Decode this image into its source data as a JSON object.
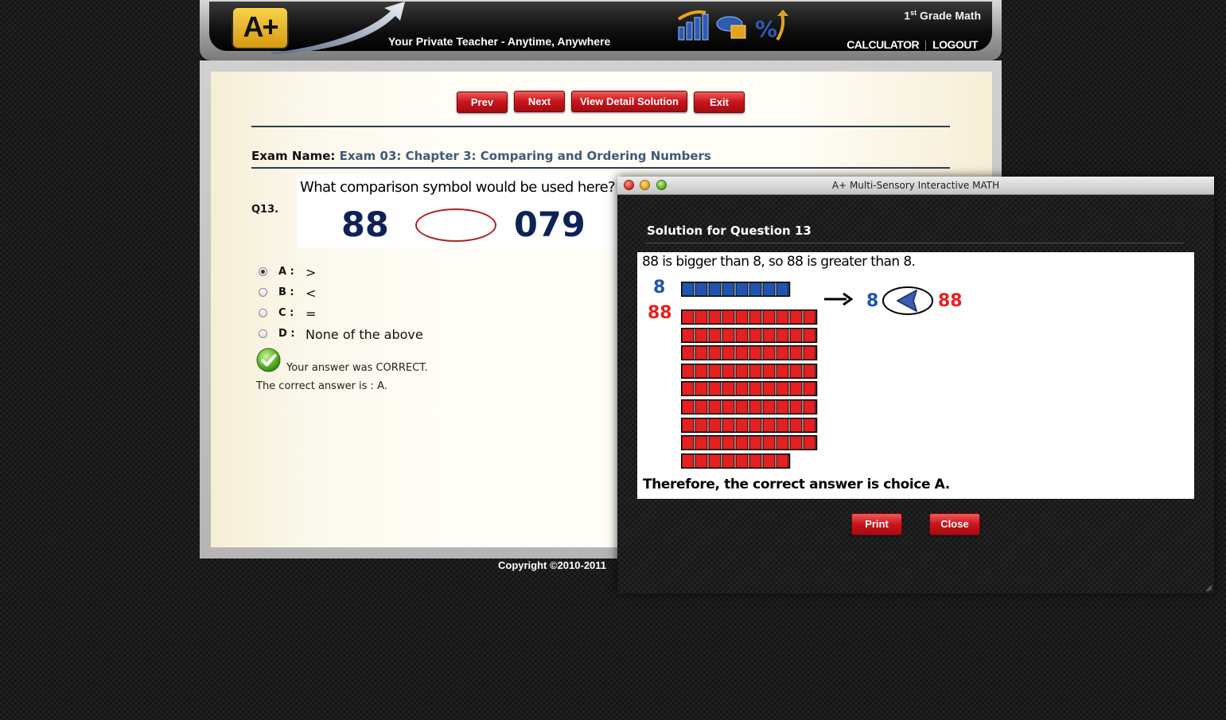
{
  "header": {
    "logo_text": "A+",
    "tagline": "Your Private Teacher - Anytime, Anywhere",
    "grade_num": "1",
    "grade_suffix": "st",
    "grade_rest": " Grade Math",
    "calculator_label": "CALCULATOR",
    "logout_label": "LOGOUT",
    "icons": [
      "bar-chart-icon",
      "geometry-shapes-icon",
      "percent-arrow-icon"
    ]
  },
  "toolbar": {
    "prev_label": "Prev",
    "next_label": "Next",
    "view_solution_label": "View Detail Solution",
    "exit_label": "Exit"
  },
  "exam": {
    "name_label": "Exam Name:",
    "name_value": "Exam 03: Chapter 3: Comparing and Ordering Numbers"
  },
  "question": {
    "number": "Q13.",
    "text": "What comparison symbol would be used here?",
    "left_number": "88",
    "right_number": "079",
    "options": [
      {
        "letter": "A :",
        "text": ">",
        "selected": true
      },
      {
        "letter": "B :",
        "text": "<",
        "selected": false
      },
      {
        "letter": "C :",
        "text": "=",
        "selected": false
      },
      {
        "letter": "D :",
        "text": "None of the above",
        "selected": false
      }
    ],
    "result_message": "Your answer was CORRECT.",
    "correct_answer_message": "The correct answer is : A."
  },
  "footer": {
    "copyright": "Copyright ©2010-2011"
  },
  "popup": {
    "window_title": "A+ Multi-Sensory Interactive MATH",
    "solution_title": "Solution for Question 13",
    "explanation": "88 is bigger than 8, so 88 is greater than 8.",
    "label_small": "8",
    "label_large": "88",
    "compare_left": "8",
    "compare_right": "88",
    "small_units": 8,
    "large_units": 88,
    "conclusion": "Therefore, the correct answer is choice A.",
    "print_label": "Print",
    "close_label": "Close"
  },
  "colors": {
    "button_red": "#c9141a",
    "number_navy": "#0e2258",
    "solution_blue": "#1f55b0",
    "solution_red": "#e52020",
    "exam_value": "#3e5a7c"
  }
}
